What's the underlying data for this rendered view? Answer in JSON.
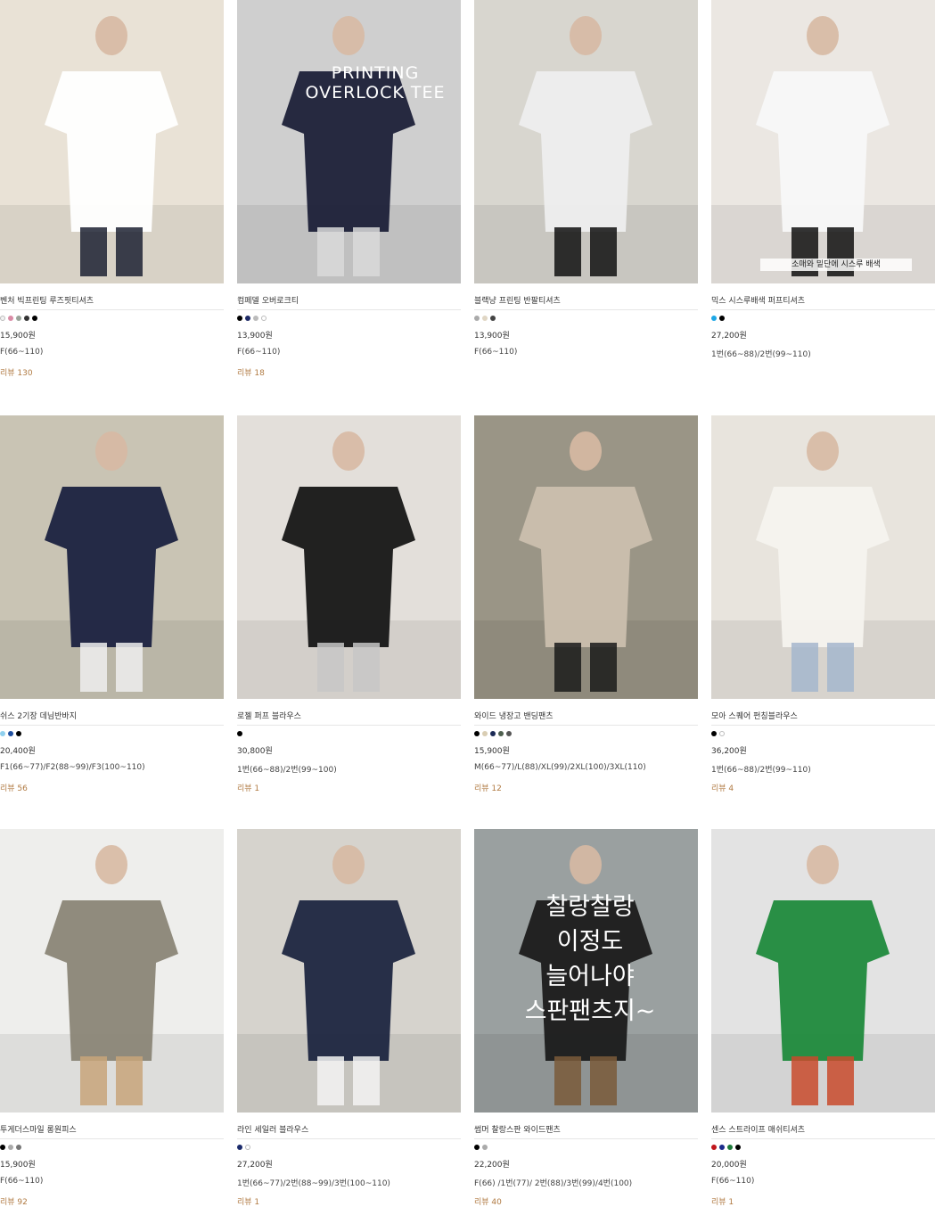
{
  "products": [
    {
      "name": "벤처 빅프린팅 루즈핏티셔츠",
      "colors": [
        "#f2f2f2",
        "#d98ca6",
        "#9aa49a",
        "#333333",
        "#000000"
      ],
      "price": "15,900원",
      "size": "F(66~110)",
      "review": "리뷰 130",
      "image": {
        "bg": "#e9e2d6",
        "accent": "#ffffff",
        "accent2": "#1d2233",
        "icon": "tshirt-outfit-photo"
      }
    },
    {
      "name": "컴페델 오버로크티",
      "colors": [
        "#000000",
        "#1e2a66",
        "#bbbbbb",
        "#ffffff"
      ],
      "price": "13,900원",
      "size": "F(66~110)",
      "review": "리뷰 18",
      "image": {
        "bg": "#cfcfcf",
        "accent": "#1c2038",
        "accent2": "#d9d9d9",
        "icon": "overlock-tee-photo",
        "overlay": "PRINTING\nOVERLOCK TEE"
      }
    },
    {
      "name": "블랙냥 프린팅 반팔티셔츠",
      "colors": [
        "#aaaaaa",
        "#e0d6c4",
        "#444444"
      ],
      "price": "13,900원",
      "size": "F(66~110)",
      "review": "",
      "image": {
        "bg": "#d8d6cf",
        "accent": "#eeeeee",
        "accent2": "#111111",
        "icon": "cat-tshirt-photo"
      }
    },
    {
      "name": "믹스 시스루배색 퍼프티셔츠",
      "colors": [
        "#1ea7e6",
        "#000000"
      ],
      "price": "27,200원",
      "size": "1번(66~88)/2번(99~110)",
      "review": "",
      "image": {
        "bg": "#ebe7e2",
        "accent": "#f8f8f8",
        "accent2": "#111111",
        "icon": "seethrough-tshirt-photo",
        "overlay": "소매와 밑단에 시스루 배색"
      }
    },
    {
      "name": "쉬스 2기장 데님반바지",
      "colors": [
        "#8fd0ee",
        "#1f4fa0",
        "#000000"
      ],
      "price": "20,400원",
      "size": "F1(66~77)/F2(88~99)/F3(100~110)",
      "review": "리뷰 56",
      "image": {
        "bg": "#c9c4b4",
        "accent": "#1b2240",
        "accent2": "#eeeeee",
        "icon": "denim-shorts-photo"
      }
    },
    {
      "name": "로젤 퍼프 블라우스",
      "colors": [
        "#000000"
      ],
      "price": "30,800원",
      "size": "1번(66~88)/2번(99~100)",
      "review": "리뷰 1",
      "image": {
        "bg": "#e3dfda",
        "accent": "#161616",
        "accent2": "#c7c7c7",
        "icon": "black-blouse-photo"
      }
    },
    {
      "name": "와이드 냉장고 밴딩팬츠",
      "colors": [
        "#000000",
        "#d9cdb3",
        "#1b2a55",
        "#4e5f4e",
        "#555555"
      ],
      "price": "15,900원",
      "size": "M(66~77)/L(88)/XL(99)/2XL(100)/3XL(110)",
      "review": "리뷰 12",
      "image": {
        "bg": "#9a9586",
        "accent": "#cbbfae",
        "accent2": "#1a1a1a",
        "icon": "wide-pants-photo"
      }
    },
    {
      "name": "모아 스퀘어 펀칭블라우스",
      "colors": [
        "#000000",
        "#ffffff"
      ],
      "price": "36,200원",
      "size": "1번(66~88)/2번(99~110)",
      "review": "리뷰 4",
      "image": {
        "bg": "#e8e4dd",
        "accent": "#f5f3ee",
        "accent2": "#a4b6cc",
        "icon": "punching-blouse-photo"
      }
    },
    {
      "name": "투게더스마일 롱원피스",
      "colors": [
        "#000000",
        "#aaaaaa",
        "#777777"
      ],
      "price": "15,900원",
      "size": "F(66~110)",
      "review": "리뷰 92",
      "image": {
        "bg": "#eeeeec",
        "accent": "#8a8577",
        "accent2": "#c8a57a",
        "icon": "smile-dress-photo"
      }
    },
    {
      "name": "라인 세일러 블라우스",
      "colors": [
        "#1b2b6b",
        "#ffffff"
      ],
      "price": "27,200원",
      "size": "1번(66~77)/2번(88~99)/3번(100~110)",
      "review": "리뷰 1",
      "image": {
        "bg": "#d6d3cd",
        "accent": "#1d2640",
        "accent2": "#f3f3f3",
        "icon": "sailor-blouse-photo"
      }
    },
    {
      "name": "썸머 찰랑스판 와이드팬츠",
      "colors": [
        "#000000",
        "#aaaaaa"
      ],
      "price": "22,200원",
      "size": "F(66) /1번(77)/ 2번(88)/3번(99)/4번(100)",
      "review": "리뷰 40",
      "image": {
        "bg": "#9aa0a0",
        "accent": "#1b1b1b",
        "accent2": "#7a5a3a",
        "icon": "span-pants-photo",
        "overlay": "찰랑찰랑\n이정도\n늘어나야\n스판팬츠지~"
      }
    },
    {
      "name": "센스 스트라이프 매쉬티셔츠",
      "colors": [
        "#c0161c",
        "#1b2b8b",
        "#1e7a3a",
        "#000000"
      ],
      "price": "20,000원",
      "size": "F(66~110)",
      "review": "리뷰 1",
      "image": {
        "bg": "#e3e3e3",
        "accent": "#1f8a3c",
        "accent2": "#c84a2c",
        "icon": "striped-mesh-tshirt-photo"
      }
    }
  ]
}
